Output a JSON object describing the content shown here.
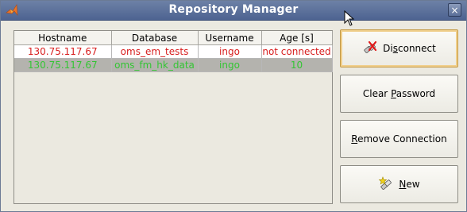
{
  "window": {
    "title": "Repository Manager",
    "close_glyph": "×"
  },
  "table": {
    "columns": [
      "Hostname",
      "Database",
      "Username",
      "Age [s]"
    ],
    "rows": [
      {
        "hostname": "130.75.117.67",
        "database": "oms_em_tests",
        "username": "ingo",
        "age": "not connected",
        "status_color": "#d81e1e",
        "selected": false
      },
      {
        "hostname": "130.75.117.67",
        "database": "oms_fm_hk_data",
        "username": "ingo",
        "age": "10",
        "status_color": "#34c534",
        "selected": true
      }
    ]
  },
  "buttons": {
    "disconnect": {
      "pre": "Di",
      "mnemonic": "s",
      "post": "connect",
      "icon": "disconnect-plug-icon"
    },
    "clear_password": {
      "pre": "Clear ",
      "mnemonic": "P",
      "post": "assword"
    },
    "remove_connection": {
      "pre": "",
      "mnemonic": "R",
      "post": "emove Connection"
    },
    "new": {
      "pre": "",
      "mnemonic": "N",
      "post": "ew",
      "icon": "new-plug-icon"
    }
  },
  "colors": {
    "title_bar": "#5a6e98",
    "focus_border": "#c49a46",
    "connected": "#34c534",
    "disconnected": "#d81e1e"
  }
}
